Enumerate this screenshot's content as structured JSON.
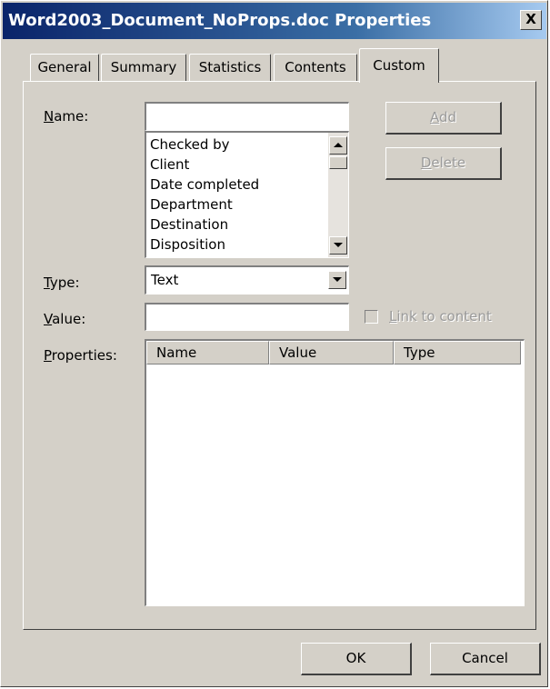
{
  "window": {
    "title": "Word2003_Document_NoProps.doc Properties",
    "close_glyph": "X"
  },
  "tabs": [
    {
      "label": "General"
    },
    {
      "label": "Summary"
    },
    {
      "label": "Statistics"
    },
    {
      "label": "Contents"
    },
    {
      "label": "Custom",
      "active": true
    }
  ],
  "form": {
    "name_label_accel": "N",
    "name_label_rest": "ame:",
    "name_value": "",
    "name_options": [
      "Checked by",
      "Client",
      "Date completed",
      "Department",
      "Destination",
      "Disposition"
    ],
    "type_label_accel": "T",
    "type_label_rest": "ype:",
    "type_value": "Text",
    "value_label_accel": "V",
    "value_label_rest": "alue:",
    "value_value": "",
    "link_label_accel": "L",
    "link_label_rest": "ink to content",
    "link_checked": false,
    "properties_label_accel": "P",
    "properties_label_rest": "roperties:"
  },
  "buttons": {
    "add_accel": "A",
    "add_rest": "dd",
    "delete_accel": "D",
    "delete_rest": "elete",
    "ok": "OK",
    "cancel": "Cancel"
  },
  "properties_table": {
    "columns": [
      "Name",
      "Value",
      "Type"
    ],
    "rows": []
  }
}
